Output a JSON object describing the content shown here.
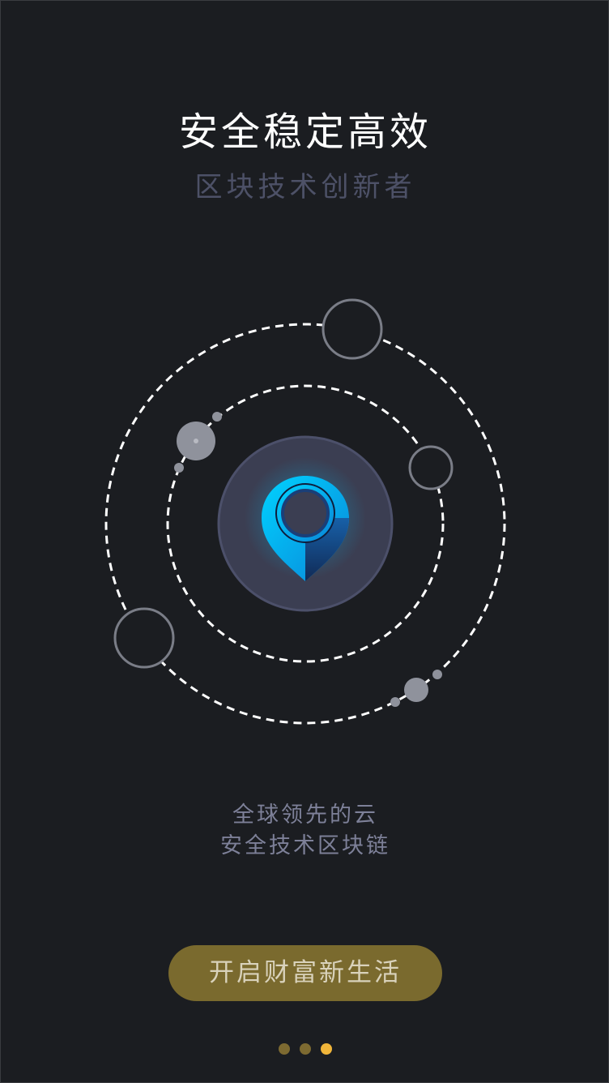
{
  "header": {
    "title": "安全稳定高效",
    "subtitle": "区块技术创新者"
  },
  "illustration": {
    "center_icon": "location-pin-icon"
  },
  "tagline": {
    "line1": "全球领先的云",
    "line2": "安全技术区块链"
  },
  "cta": {
    "label": "开启财富新生活"
  },
  "pager": {
    "count": 3,
    "active_index": 2
  },
  "colors": {
    "background": "#1b1d21",
    "title": "#ffffff",
    "subtitle": "#4d5167",
    "tagline": "#7d8098",
    "button": "#7a6a2e",
    "button_text": "#d9d2bb",
    "pin_accent": "#00c6ff",
    "dot_inactive": "#7d6a31",
    "dot_active": "#f0b53a"
  }
}
